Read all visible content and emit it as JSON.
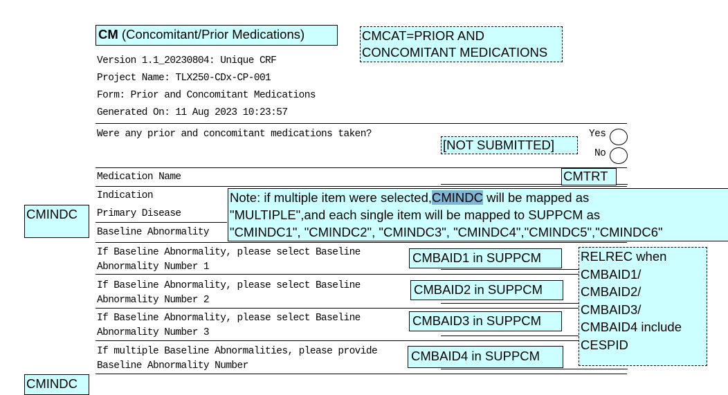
{
  "header": {
    "domain_code": "CM",
    "domain_name": "(Concomitant/Prior Medications)",
    "category_note_line1": "CMCAT=PRIOR AND",
    "category_note_line2": "CONCOMITANT MEDICATIONS"
  },
  "meta": {
    "version": "Version 1.1_20230804: Unique CRF",
    "project": "Project Name: TLX250-CDx-CP-001",
    "form": "Form: Prior and Concomitant Medications",
    "generated": "Generated On: 11 Aug 2023 10:23:57"
  },
  "question": {
    "text": "Were any prior and concomitant medications taken?",
    "not_submitted": "[NOT SUBMITTED]",
    "options": [
      "Yes",
      "No"
    ]
  },
  "fields": {
    "medication_name": "Medication Name",
    "medication_var": "CMTRT",
    "indication": "Indication",
    "primary_disease": "Primary Disease",
    "baseline_abnormality": "Baseline Abnormality",
    "indication_var": "CMINDC",
    "bottom_var_partial": "CMINDC"
  },
  "note": {
    "line1_before": "Note: if multiple item were selected,",
    "line1_highlight": "CMINDC",
    "line1_after": " will be mapped as",
    "line2": "\"MULTIPLE\",and each single item will be mapped to SUPPCM as",
    "line3": "\"CMINDC1\", \"CMINDC2\", \"CMINDC3\", \"CMINDC4\",\"CMINDC5\",\"CMINDC6\""
  },
  "baseline_rows": [
    {
      "line1": "If Baseline Abnormality, please select Baseline",
      "line2": "Abnormality Number 1",
      "var": "CMBAID1 in SUPPCM"
    },
    {
      "line1": "If Baseline Abnormality, please select Baseline",
      "line2": "Abnormality Number 2",
      "var": "CMBAID2 in SUPPCM"
    },
    {
      "line1": "If Baseline Abnormality, please select Baseline",
      "line2": "Abnormality Number 3",
      "var": "CMBAID3 in SUPPCM"
    },
    {
      "line1": "If multiple Baseline Abnormalities, please provide",
      "line2": "Baseline Abnormality Number",
      "var": "CMBAID4 in SUPPCM"
    }
  ],
  "relrec_note": [
    "RELREC when",
    "CMBAID1/",
    "CMBAID2/",
    "CMBAID3/",
    "CMBAID4 include",
    "CESPID"
  ],
  "colors": {
    "annotation_fill": "#ccffff",
    "highlight": "#7fb6d6"
  }
}
